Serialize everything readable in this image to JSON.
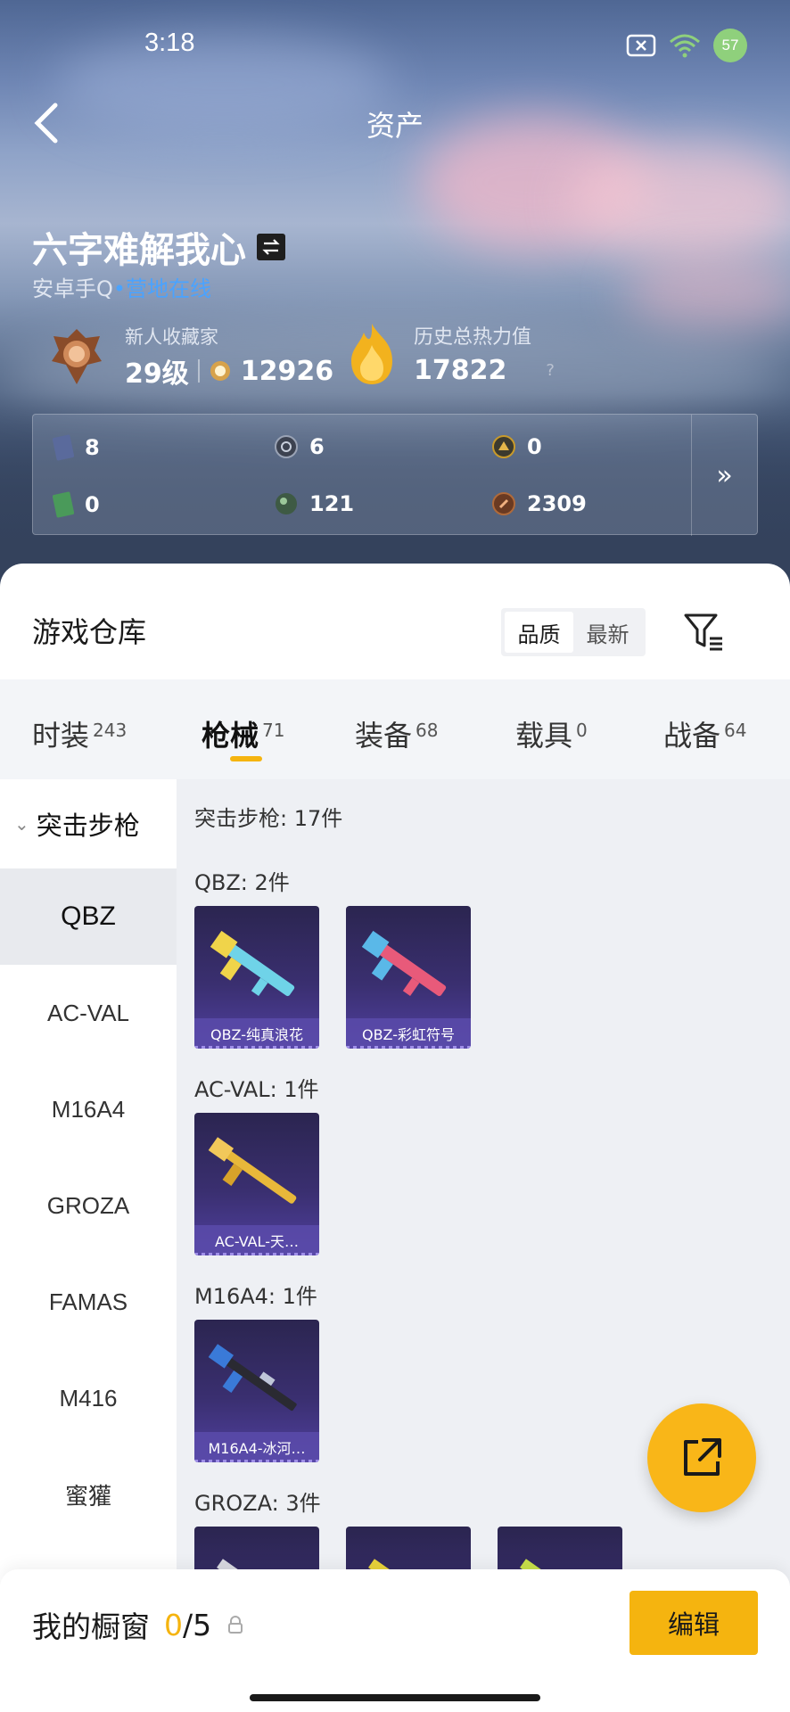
{
  "status_bar": {
    "time": "3:18",
    "battery": "57"
  },
  "nav": {
    "title": "资产"
  },
  "profile": {
    "name": "六字难解我心",
    "platform": "安卓手Q",
    "dot": "•",
    "online_status": "营地在线",
    "rank_title": "新人收藏家",
    "level": "29级",
    "points": "12926",
    "heat_title": "历史总热力值",
    "heat_value": "17822",
    "help": "?"
  },
  "resources": [
    {
      "icon": "card-icon",
      "value": "8",
      "color": "#5a6a9c"
    },
    {
      "icon": "silver-coin-icon",
      "value": "6",
      "color": "#6b7383"
    },
    {
      "icon": "gold-token-icon",
      "value": "0",
      "color": "#c89a2a"
    },
    {
      "icon": "green-card-icon",
      "value": "0",
      "color": "#4a9a5a"
    },
    {
      "icon": "green-orb-icon",
      "value": "121",
      "color": "#5e7d5e"
    },
    {
      "icon": "bronze-coin-icon",
      "value": "2309",
      "color": "#b06a3a"
    }
  ],
  "resources_more": "»",
  "warehouse": {
    "title": "游戏仓库",
    "sort_options": [
      "品质",
      "最新"
    ],
    "sort_selected": "品质"
  },
  "tabs": [
    {
      "label": "时装",
      "count": "243"
    },
    {
      "label": "枪械",
      "count": "71"
    },
    {
      "label": "装备",
      "count": "68"
    },
    {
      "label": "载具",
      "count": "0"
    },
    {
      "label": "战备",
      "count": "64"
    }
  ],
  "active_tab": "枪械",
  "sidebar": {
    "group": "突击步枪",
    "items": [
      "QBZ",
      "AC-VAL",
      "M16A4",
      "GROZA",
      "FAMAS",
      "M416",
      "蜜獾"
    ],
    "selected": "QBZ"
  },
  "content": {
    "category_title": "突击步枪: 17件",
    "groups": [
      {
        "title": "QBZ: 2件",
        "items": [
          "QBZ-纯真浪花",
          "QBZ-彩虹符号"
        ]
      },
      {
        "title": "AC-VAL: 1件",
        "items": [
          "AC-VAL-天…"
        ]
      },
      {
        "title": "M16A4: 1件",
        "items": [
          "M16A4-冰河…"
        ]
      },
      {
        "title": "GROZA: 3件",
        "items": [
          "",
          "",
          ""
        ]
      }
    ]
  },
  "showcase": {
    "title": "我的橱窗",
    "current": "0",
    "total": "/5",
    "edit_label": "编辑"
  },
  "colors": {
    "accent": "#f5b40f",
    "online": "#4aa3ff",
    "card_bg": "#3a2f70"
  }
}
